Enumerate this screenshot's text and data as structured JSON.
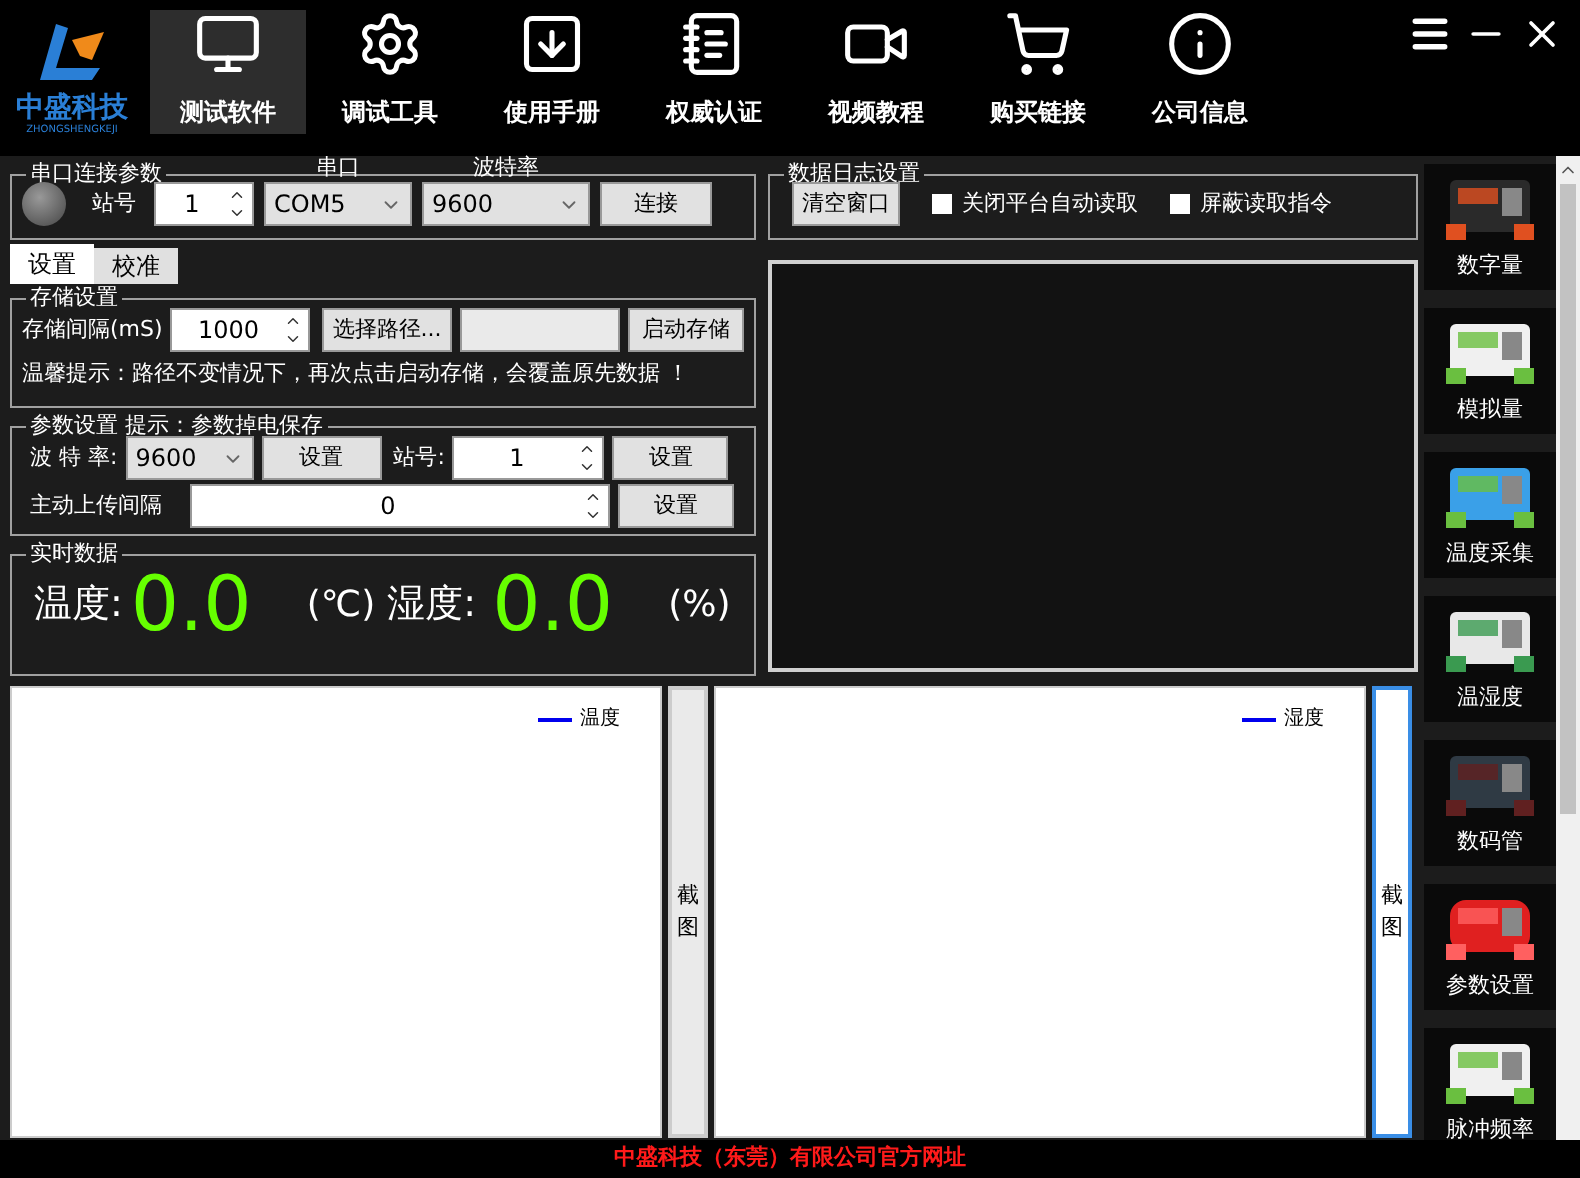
{
  "logo": {
    "name": "中盛科技",
    "subtitle": "ZHONGSHENGKEJI"
  },
  "nav": [
    {
      "label": "测试软件",
      "selected": true
    },
    {
      "label": "调试工具",
      "selected": false
    },
    {
      "label": "使用手册",
      "selected": false
    },
    {
      "label": "权威认证",
      "selected": false
    },
    {
      "label": "视频教程",
      "selected": false
    },
    {
      "label": "购买链接",
      "selected": false
    },
    {
      "label": "公司信息",
      "selected": false
    }
  ],
  "connection": {
    "title": "串口连接参数",
    "indicator_on": false,
    "station_label": "站号",
    "station": "1",
    "port_label": "串口",
    "port": "COM5",
    "baud_label": "波特率",
    "baud": "9600",
    "connect_button": "连接"
  },
  "tabs": [
    {
      "label": "设置",
      "selected": true
    },
    {
      "label": "校准",
      "selected": false
    }
  ],
  "storage": {
    "title": "存储设置",
    "interval_label": "存储间隔(mS)",
    "interval": "1000",
    "path_button": "选择路径...",
    "start_button": "启动存储",
    "hint": "温馨提示：路径不变情况下，再次点击启动存储，会覆盖原先数据 ！"
  },
  "params": {
    "title": "参数设置 提示：参数掉电保存",
    "baud_label": "波 特 率:",
    "baud": "9600",
    "baud_button": "设置",
    "station_label": "站号:",
    "station": "1",
    "station_button": "设置",
    "upload_label": "主动上传间隔",
    "upload": "0",
    "upload_button": "设置"
  },
  "realtime": {
    "title": "实时数据",
    "temp_label": "温度:",
    "temp": "0.0",
    "temp_unit": "(℃)",
    "hum_label": "湿度:",
    "hum": "0.0",
    "hum_unit": "(%)"
  },
  "log": {
    "title": "数据日志设置",
    "clear_button": "清空窗口",
    "options": [
      {
        "label": "关闭平台自动读取",
        "checked": false
      },
      {
        "label": "屏蔽读取指令",
        "checked": false
      }
    ]
  },
  "charts": [
    {
      "legend": "温度",
      "snapshot_button": "截图"
    },
    {
      "legend": "湿度",
      "snapshot_button": "截图"
    }
  ],
  "sidebar": {
    "items": [
      {
        "label": "数字量"
      },
      {
        "label": "模拟量"
      },
      {
        "label": "温度采集"
      },
      {
        "label": "温湿度"
      },
      {
        "label": "数码管"
      },
      {
        "label": "参数设置"
      },
      {
        "label": "脉冲频率"
      }
    ]
  },
  "footer": "中盛科技（东莞）有限公司官方网址"
}
